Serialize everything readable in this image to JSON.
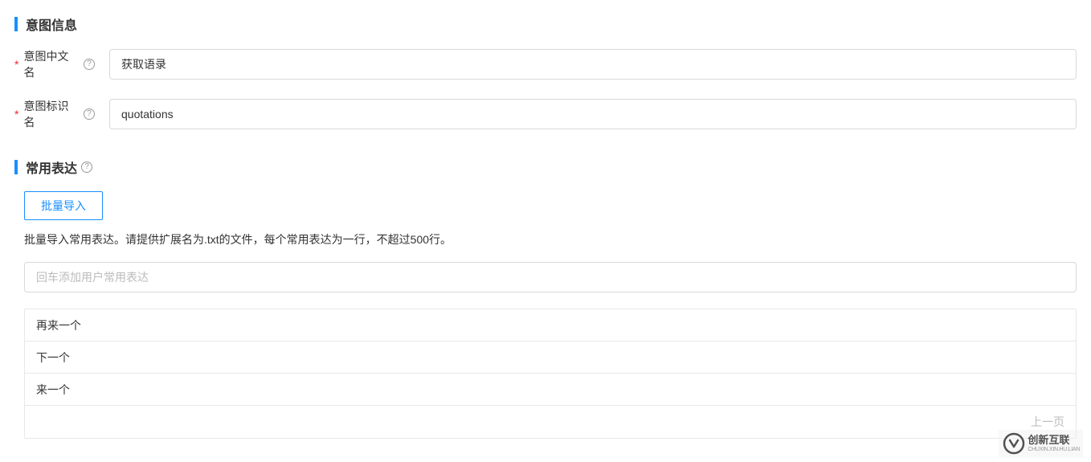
{
  "section1": {
    "title": "意图信息",
    "fields": {
      "cn_name": {
        "label": "意图中文名",
        "value": "获取语录"
      },
      "id_name": {
        "label": "意图标识名",
        "value": "quotations"
      }
    }
  },
  "section2": {
    "title": "常用表达",
    "import_button": "批量导入",
    "hint": "批量导入常用表达。请提供扩展名为.txt的文件，每个常用表达为一行，不超过500行。",
    "add_placeholder": "回车添加用户常用表达",
    "items": [
      "再来一个",
      "下一个",
      "来一个"
    ],
    "pager_prev": "上一页"
  },
  "watermark": {
    "brand": "创新互联",
    "sub": "CHUXIN.XIN.HU.LIAN"
  }
}
